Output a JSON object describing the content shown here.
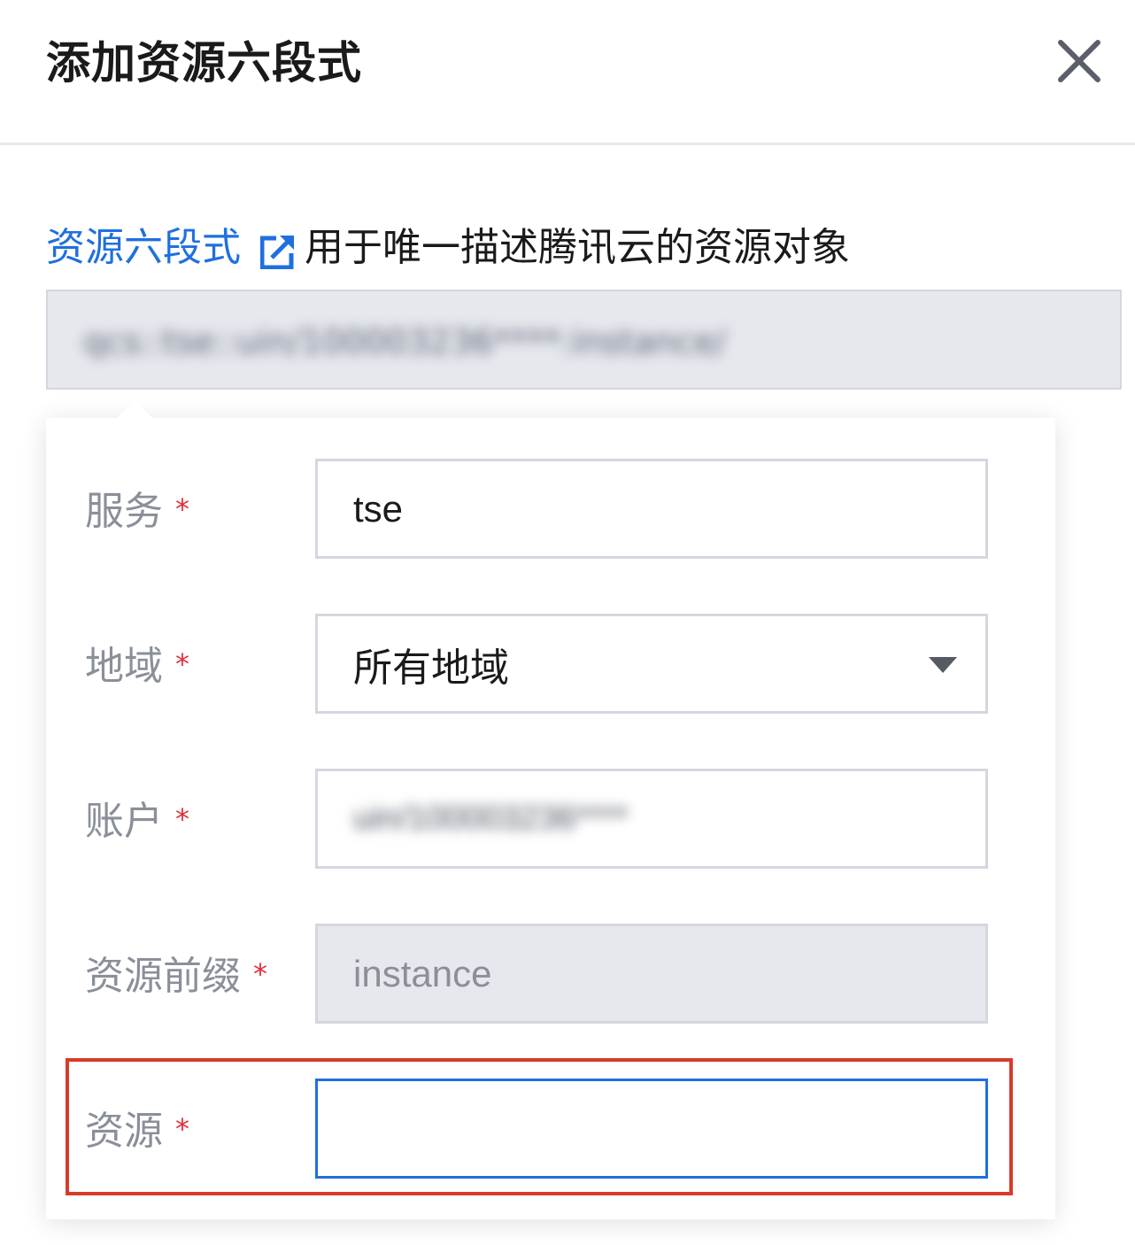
{
  "dialog": {
    "title": "添加资源六段式",
    "close_icon": "close-icon"
  },
  "description": {
    "link_text": "资源六段式",
    "link_icon": "external-link-icon",
    "text": "用于唯一描述腾讯云的资源对象"
  },
  "preview": {
    "value": "qcs::tse::uin/100003236****:instance/"
  },
  "form": {
    "required_mark": "*",
    "service": {
      "label": "服务",
      "value": "tse"
    },
    "region": {
      "label": "地域",
      "value": "所有地域",
      "icon": "chevron-down-icon"
    },
    "account": {
      "label": "账户",
      "value": "uin/100003236****"
    },
    "resource_prefix": {
      "label": "资源前缀",
      "value": "instance"
    },
    "resource": {
      "label": "资源",
      "value": ""
    }
  },
  "colors": {
    "accent": "#1f6fe0",
    "required": "#e0313b",
    "highlight": "#d93a2b",
    "disabled_bg": "#e6e8ee"
  }
}
